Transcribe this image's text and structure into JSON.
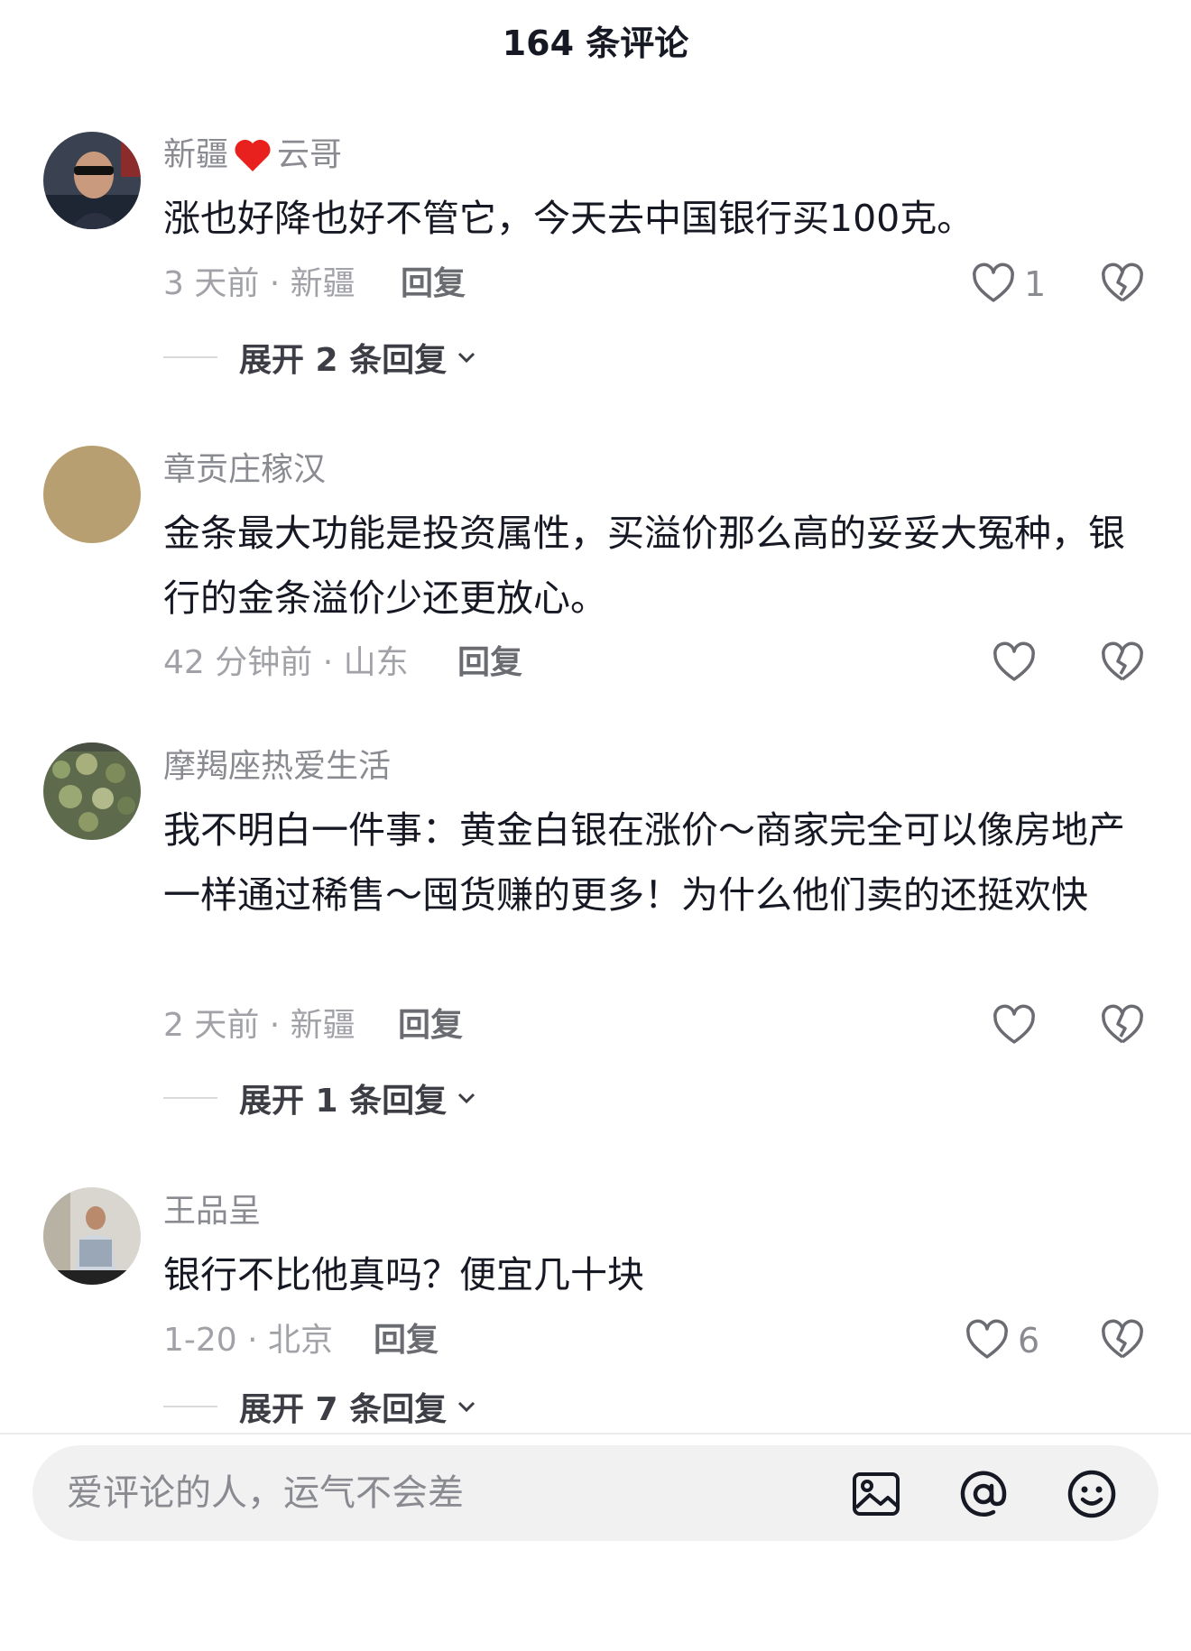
{
  "header": {
    "title": "164 条评论"
  },
  "comments": [
    {
      "username": "新疆",
      "username_suffix": "云哥",
      "text": "涨也好降也好不管它，今天去中国银行买100克。",
      "time_location": "3 天前 · 新疆",
      "reply_label": "回复",
      "likes": "1",
      "expand_label": "展开 2 条回复"
    },
    {
      "username": "章贡庄稼汉",
      "text": "金条最大功能是投资属性，买溢价那么高的妥妥大冤种，银行的金条溢价少还更放心。",
      "time_location": "42 分钟前 · 山东",
      "reply_label": "回复",
      "likes": ""
    },
    {
      "username": "摩羯座热爱生活",
      "text": "我不明白一件事：黄金白银在涨价～商家完全可以像房地产一样通过稀售～囤货赚的更多！为什么他们卖的还挺欢快",
      "time_location": "2 天前 · 新疆",
      "reply_label": "回复",
      "likes": "",
      "expand_label": "展开 1 条回复"
    },
    {
      "username": "王品呈",
      "text": "银行不比他真吗？便宜几十块",
      "time_location": "1-20 · 北京",
      "reply_label": "回复",
      "likes": "6",
      "expand_label": "展开 7 条回复"
    }
  ],
  "input_bar": {
    "placeholder": "爱评论的人，运气不会差",
    "icons": [
      "image-icon",
      "at-icon",
      "emoji-icon"
    ]
  },
  "colors": {
    "text_primary": "#161823",
    "text_secondary": "#8a8b91",
    "input_bg": "#f1f1f2"
  }
}
